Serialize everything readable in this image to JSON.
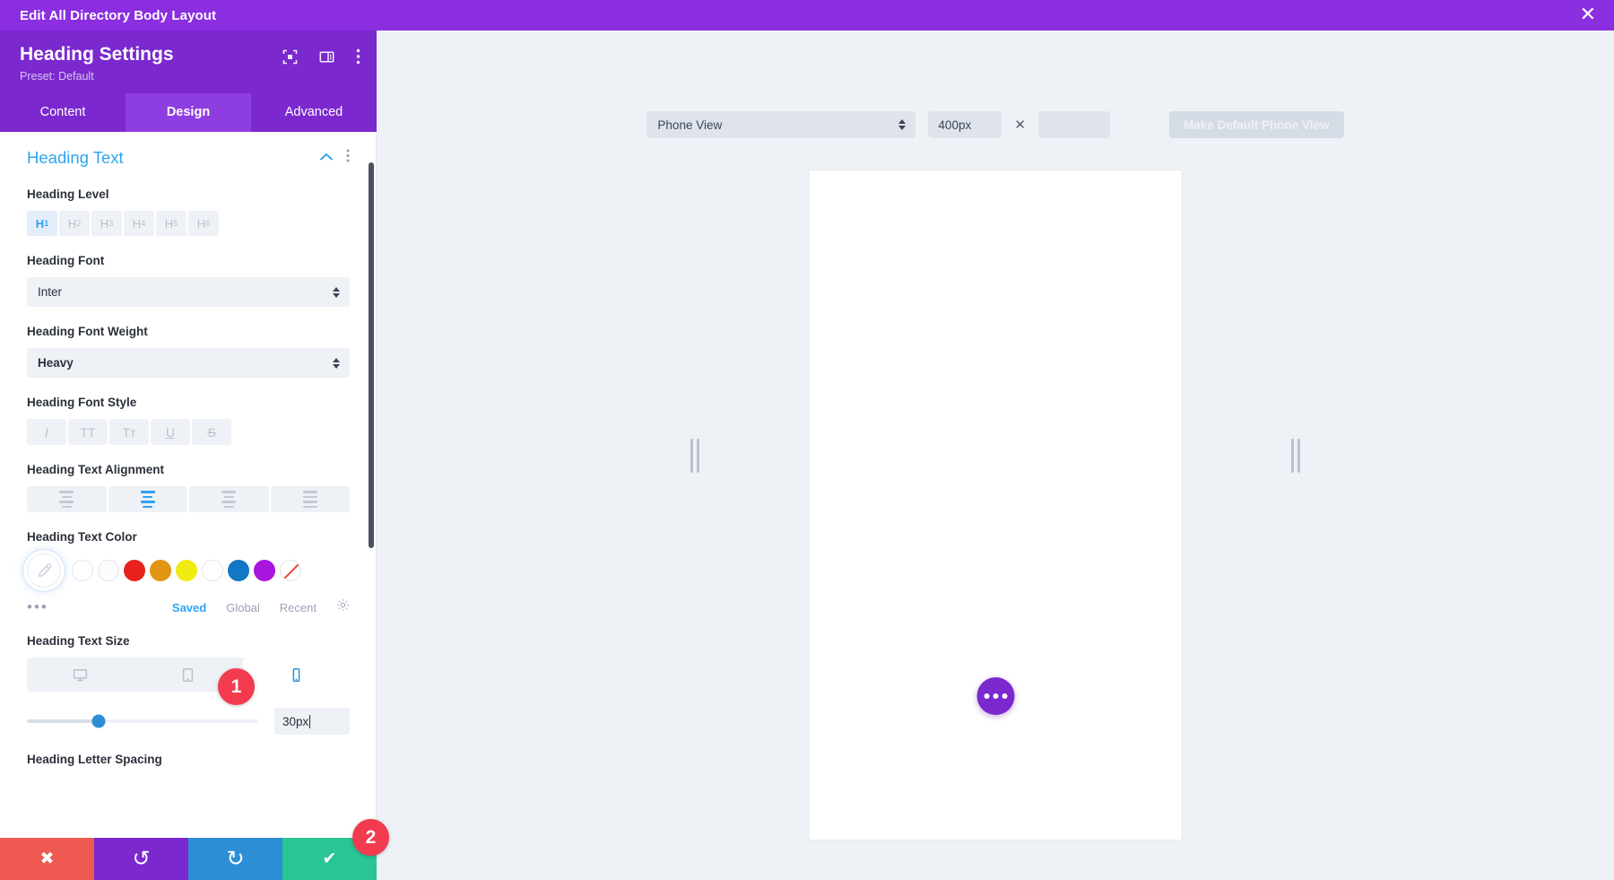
{
  "window": {
    "title": "Edit All Directory Body Layout",
    "close_icon": "close-icon"
  },
  "panel": {
    "title": "Heading Settings",
    "preset": "Preset: Default",
    "header_icons": [
      "focus-target-icon",
      "layout-columns-icon",
      "vertical-dots-icon"
    ],
    "tabs": [
      {
        "label": "Content",
        "active": false
      },
      {
        "label": "Design",
        "active": true
      },
      {
        "label": "Advanced",
        "active": false
      }
    ],
    "section": {
      "title": "Heading Text",
      "collapse_icon": "chevron-up-icon",
      "options_icon": "vertical-dots-icon"
    },
    "heading_level": {
      "label": "Heading Level",
      "options": [
        {
          "label": "H",
          "sub": "1",
          "active": true
        },
        {
          "label": "H",
          "sub": "2",
          "active": false
        },
        {
          "label": "H",
          "sub": "3",
          "active": false
        },
        {
          "label": "H",
          "sub": "4",
          "active": false
        },
        {
          "label": "H",
          "sub": "5",
          "active": false
        },
        {
          "label": "H",
          "sub": "6",
          "active": false
        }
      ]
    },
    "heading_font": {
      "label": "Heading Font",
      "value": "Inter"
    },
    "heading_font_weight": {
      "label": "Heading Font Weight",
      "value": "Heavy"
    },
    "heading_font_style": {
      "label": "Heading Font Style",
      "options": [
        {
          "glyph": "I",
          "name": "italic-icon",
          "active": false
        },
        {
          "glyph": "TT",
          "name": "uppercase-icon",
          "active": false
        },
        {
          "glyph": "Tᴛ",
          "name": "small-caps-icon",
          "active": false
        },
        {
          "glyph": "U",
          "name": "underline-icon",
          "active": false
        },
        {
          "glyph": "S",
          "name": "strikethrough-icon",
          "active": false
        }
      ]
    },
    "heading_text_alignment": {
      "label": "Heading Text Alignment",
      "options": [
        {
          "name": "align-left-icon",
          "active": false
        },
        {
          "name": "align-center-icon",
          "active": true
        },
        {
          "name": "align-right-icon",
          "active": false
        },
        {
          "name": "align-justify-icon",
          "active": false
        }
      ]
    },
    "heading_text_color": {
      "label": "Heading Text Color",
      "picker_icon": "eyedropper-icon",
      "swatches": [
        {
          "name": "swatch-white-1",
          "color": "#ffffff"
        },
        {
          "name": "swatch-white-2",
          "color": "#fcfcfc"
        },
        {
          "name": "swatch-red",
          "color": "#e8231f"
        },
        {
          "name": "swatch-orange",
          "color": "#e09612"
        },
        {
          "name": "swatch-yellow",
          "color": "#f0ec12"
        },
        {
          "name": "swatch-white-3",
          "color": "#ffffff"
        },
        {
          "name": "swatch-blue",
          "color": "#1277c4"
        },
        {
          "name": "swatch-purple",
          "color": "#a915dd"
        },
        {
          "name": "swatch-none",
          "color": "transparent"
        }
      ],
      "more_dots": "•••",
      "tabs": [
        {
          "label": "Saved",
          "active": true
        },
        {
          "label": "Global",
          "active": false
        },
        {
          "label": "Recent",
          "active": false
        }
      ],
      "settings_icon": "gear-icon"
    },
    "heading_text_size": {
      "label": "Heading Text Size",
      "devices": [
        {
          "name": "desktop-icon",
          "active": false
        },
        {
          "name": "tablet-icon",
          "active": false
        },
        {
          "name": "phone-icon",
          "active": true
        }
      ],
      "value": "30px",
      "slider_percent": 31
    },
    "heading_letter_spacing": {
      "label": "Heading Letter Spacing"
    },
    "actions": [
      {
        "name": "cancel-button",
        "icon": "close-icon",
        "glyph": "✖",
        "color": "#ee5a51"
      },
      {
        "name": "undo-button",
        "icon": "undo-icon",
        "glyph": "↺",
        "color": "#7b28cf"
      },
      {
        "name": "redo-button",
        "icon": "redo-icon",
        "glyph": "↻",
        "color": "#2c8fd6"
      },
      {
        "name": "save-button",
        "icon": "check-icon",
        "glyph": "✔",
        "color": "#29c594"
      }
    ]
  },
  "preview": {
    "view_select": "Phone View",
    "width_value": "400px",
    "separator": "✕",
    "height_value": "",
    "make_default_label": "Make Default Phone View",
    "fab_icon": "more-dots-icon",
    "resize_handle_icon": "resize-handle-icon"
  },
  "badges": [
    {
      "number": "1"
    },
    {
      "number": "2"
    }
  ]
}
